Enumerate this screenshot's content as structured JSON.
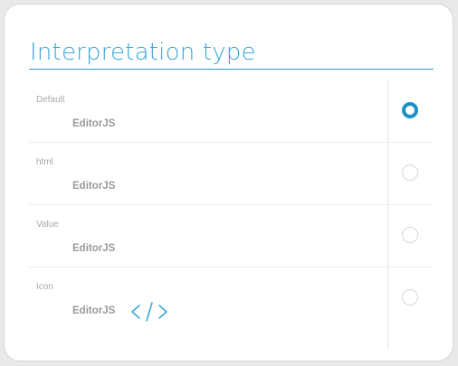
{
  "panel": {
    "title": "Interpretation type"
  },
  "options": [
    {
      "label": "Default",
      "value": "EditorJS",
      "selected": true
    },
    {
      "label": "html",
      "value": "EditorJS",
      "selected": false
    },
    {
      "label": "Value",
      "value": "EditorJS",
      "selected": false
    },
    {
      "label": "Icon",
      "value": "EditorJS",
      "selected": false,
      "icon": "code-icon"
    }
  ],
  "colors": {
    "accent": "#2a9bd0",
    "title": "#39a7d9",
    "radio_selected": "#1f8fc8"
  }
}
